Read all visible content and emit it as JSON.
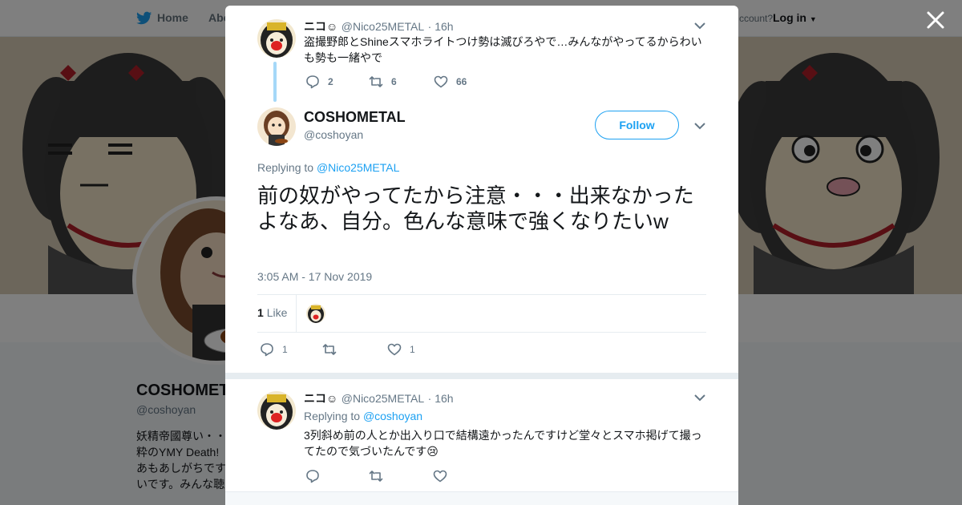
{
  "background": {
    "nav": {
      "home": "Home",
      "about": "Abo",
      "account_prompt": "ccount?",
      "login": "Log in"
    },
    "profile": {
      "name": "COSHOMET",
      "handle": "@coshoyan",
      "bio_lines": [
        "妖精帝國尊い・・",
        "粋のYMY Death! ",
        "あもあしがちです",
        "いです。みんな聴"
      ]
    }
  },
  "parent_tweet": {
    "author_name": "ニコ☺",
    "author_handle": "@Nico25METAL",
    "time": "· 16h",
    "text": "盗撮野郎とShineスマホライトつけ勢は滅びろやで…みんながやってるからわいも勢も一緒やで",
    "replies": "2",
    "retweets": "6",
    "likes": "66"
  },
  "main_tweet": {
    "author_name": "COSHOMETAL",
    "author_handle": "@coshoyan",
    "follow_label": "Follow",
    "replying_prefix": "Replying to ",
    "replying_to": "@Nico25METAL",
    "text": "前の奴がやってたから注意・・・出来なかったよなあ、自分。色んな意味で強くなりたいw",
    "timestamp": "3:05 AM - 17 Nov 2019",
    "like_count": "1",
    "like_label": "Like",
    "replies": "1",
    "retweets": "",
    "likes": "1"
  },
  "reply_tweet": {
    "author_name": "ニコ☺",
    "author_handle": "@Nico25METAL",
    "time": "· 16h",
    "replying_prefix": "Replying to ",
    "replying_to": "@coshoyan",
    "text": "3列斜め前の人とか出入り口で結構遠かったんですけど堂々とスマホ掲げて撮ってたので気づいたんです😢"
  },
  "colors": {
    "accent": "#1da1f2",
    "text": "#14171a",
    "muted": "#657786",
    "thread": "#a5d8f8"
  }
}
